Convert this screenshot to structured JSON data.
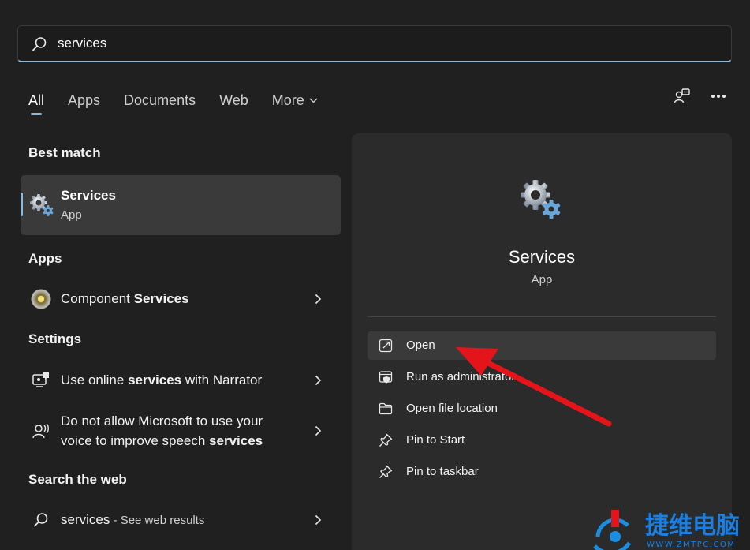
{
  "search": {
    "value": "services",
    "icon": "search-icon"
  },
  "tabs": [
    {
      "label": "All"
    },
    {
      "label": "Apps"
    },
    {
      "label": "Documents"
    },
    {
      "label": "Web"
    },
    {
      "label": "More"
    }
  ],
  "top_icons": [
    "account-switch-icon",
    "more-options-icon"
  ],
  "best_match": {
    "heading": "Best match",
    "title": "Services",
    "subtitle": "App",
    "icon": "services-gear-icon"
  },
  "apps": {
    "heading": "Apps",
    "items": [
      {
        "pre": "Component ",
        "bold": "Services",
        "post": "",
        "icon": "component-services-icon"
      }
    ]
  },
  "settings": {
    "heading": "Settings",
    "items": [
      {
        "line1_pre": "Use online ",
        "line1_bold": "services",
        "line1_post": " with Narrator",
        "icon": "narrator-icon"
      },
      {
        "line1": "Do not allow Microsoft to use your",
        "line2_pre": "voice to improve speech ",
        "line2_bold": "services",
        "icon": "speech-icon"
      }
    ]
  },
  "web": {
    "heading": "Search the web",
    "query": "services",
    "suffix": " - See web results",
    "icon": "search-icon"
  },
  "preview": {
    "title": "Services",
    "subtitle": "App",
    "icon": "services-gear-icon",
    "actions": [
      {
        "label": "Open",
        "icon": "open-external-icon"
      },
      {
        "label": "Run as administrator",
        "icon": "shield-icon"
      },
      {
        "label": "Open file location",
        "icon": "folder-icon"
      },
      {
        "label": "Pin to Start",
        "icon": "pin-icon"
      },
      {
        "label": "Pin to taskbar",
        "icon": "pin-icon"
      }
    ]
  },
  "watermark": {
    "cn_text": "捷维电脑",
    "url": "WWW.ZMTPC.COM"
  },
  "colors": {
    "accent": "#8fb8d8",
    "background": "#202020",
    "panel": "#2b2b2b",
    "annotation_arrow": "#e5141a"
  }
}
